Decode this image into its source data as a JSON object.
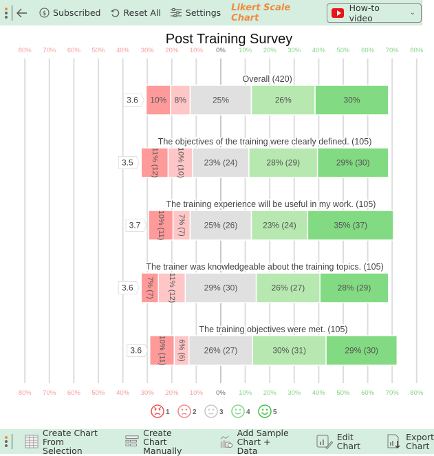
{
  "toolbar": {
    "subscribed_label": "Subscribed",
    "reset_label": "Reset All",
    "settings_label": "Settings",
    "brand_label": "Likert Scale Chart",
    "howto_label": "How-to video"
  },
  "bottombar": {
    "create_selection_line1": "Create Chart",
    "create_selection_line2": "From Selection",
    "create_manual_line1": "Create Chart",
    "create_manual_line2": "Manually",
    "add_sample_line1": "Add Sample",
    "add_sample_line2": "Chart + Data",
    "edit_line1": "Edit",
    "edit_line2": "Chart",
    "export_line1": "Export",
    "export_line2": "Chart"
  },
  "colors": {
    "level1": "#fe9a9a",
    "level2": "#fec6c6",
    "level3": "#e0e0e0",
    "level4": "#b6e8b0",
    "level5": "#82da82",
    "negative_tick": "#f4a0a0",
    "positive_tick": "#86d686",
    "zero_tick": "#666666",
    "toolbar_bg": "#d5eee0",
    "brand": "#f08a3c"
  },
  "chart_data": {
    "type": "bar",
    "subtype": "diverging-stacked-likert",
    "title": "Post Training Survey",
    "xlim": [
      -80,
      80
    ],
    "x_ticks": [
      "80%",
      "70%",
      "60%",
      "50%",
      "40%",
      "30%",
      "20%",
      "10%",
      "0%",
      "10%",
      "20%",
      "30%",
      "40%",
      "50%",
      "60%",
      "70%",
      "80%"
    ],
    "grid": true,
    "neutral_centered": true,
    "legend": {
      "placement": "bottom",
      "entries": [
        {
          "label": "1",
          "icon": "very-sad-face-icon"
        },
        {
          "label": "2",
          "icon": "sad-face-icon"
        },
        {
          "label": "3",
          "icon": "neutral-face-icon"
        },
        {
          "label": "4",
          "icon": "smile-face-icon"
        },
        {
          "label": "5",
          "icon": "big-smile-face-icon"
        }
      ]
    },
    "categories": [
      "Overall (420)",
      "The objectives of the training were clearly defined. (105)",
      "The training experience will be useful in my work. (105)",
      "The trainer was knowledgeable about the training topics. (105)",
      "The training objectives were met. (105)"
    ],
    "averages": [
      "3.6",
      "3.5",
      "3.7",
      "3.6",
      "3.6"
    ],
    "series": [
      {
        "name": "1",
        "values": [
          10,
          11,
          10,
          7,
          10
        ],
        "labels": [
          "10%",
          "11% (12)",
          "10% (11)",
          "7% (7)",
          "10% (11)"
        ]
      },
      {
        "name": "2",
        "values": [
          8,
          10,
          7,
          11,
          6
        ],
        "labels": [
          "8%",
          "10% (10)",
          "7% (7)",
          "11% (12)",
          "6% (6)"
        ]
      },
      {
        "name": "3",
        "values": [
          25,
          23,
          25,
          29,
          26
        ],
        "labels": [
          "25%",
          "23% (24)",
          "25% (26)",
          "29% (30)",
          "26% (27)"
        ]
      },
      {
        "name": "4",
        "values": [
          26,
          28,
          23,
          26,
          30
        ],
        "labels": [
          "26%",
          "28% (29)",
          "23% (24)",
          "26% (27)",
          "30% (31)"
        ]
      },
      {
        "name": "5",
        "values": [
          30,
          29,
          35,
          28,
          29
        ],
        "labels": [
          "30%",
          "29% (30)",
          "35% (37)",
          "28% (29)",
          "29% (30)"
        ]
      }
    ]
  }
}
